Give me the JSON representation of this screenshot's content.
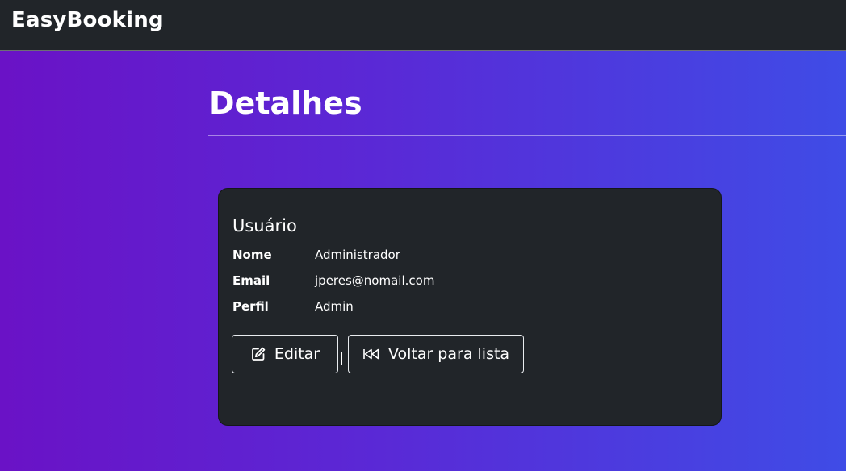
{
  "navbar": {
    "brand": "EasyBooking"
  },
  "page": {
    "title": "Detalhes"
  },
  "card": {
    "title": "Usuário",
    "fields": [
      {
        "label": "Nome",
        "value": "Administrador"
      },
      {
        "label": "Email",
        "value": "jperes@nomail.com"
      },
      {
        "label": "Perfil",
        "value": "Admin"
      }
    ],
    "buttons": {
      "edit": {
        "label": "Editar",
        "icon": "pencil-square-icon"
      },
      "back": {
        "label": "Voltar para lista",
        "icon": "rewind-icon"
      },
      "separator": "|"
    }
  },
  "colors": {
    "navbar_bg": "#212529",
    "card_bg": "#212529",
    "gradient_start": "#6a12c6",
    "gradient_end": "#3f4ce6",
    "text": "#ffffff"
  }
}
